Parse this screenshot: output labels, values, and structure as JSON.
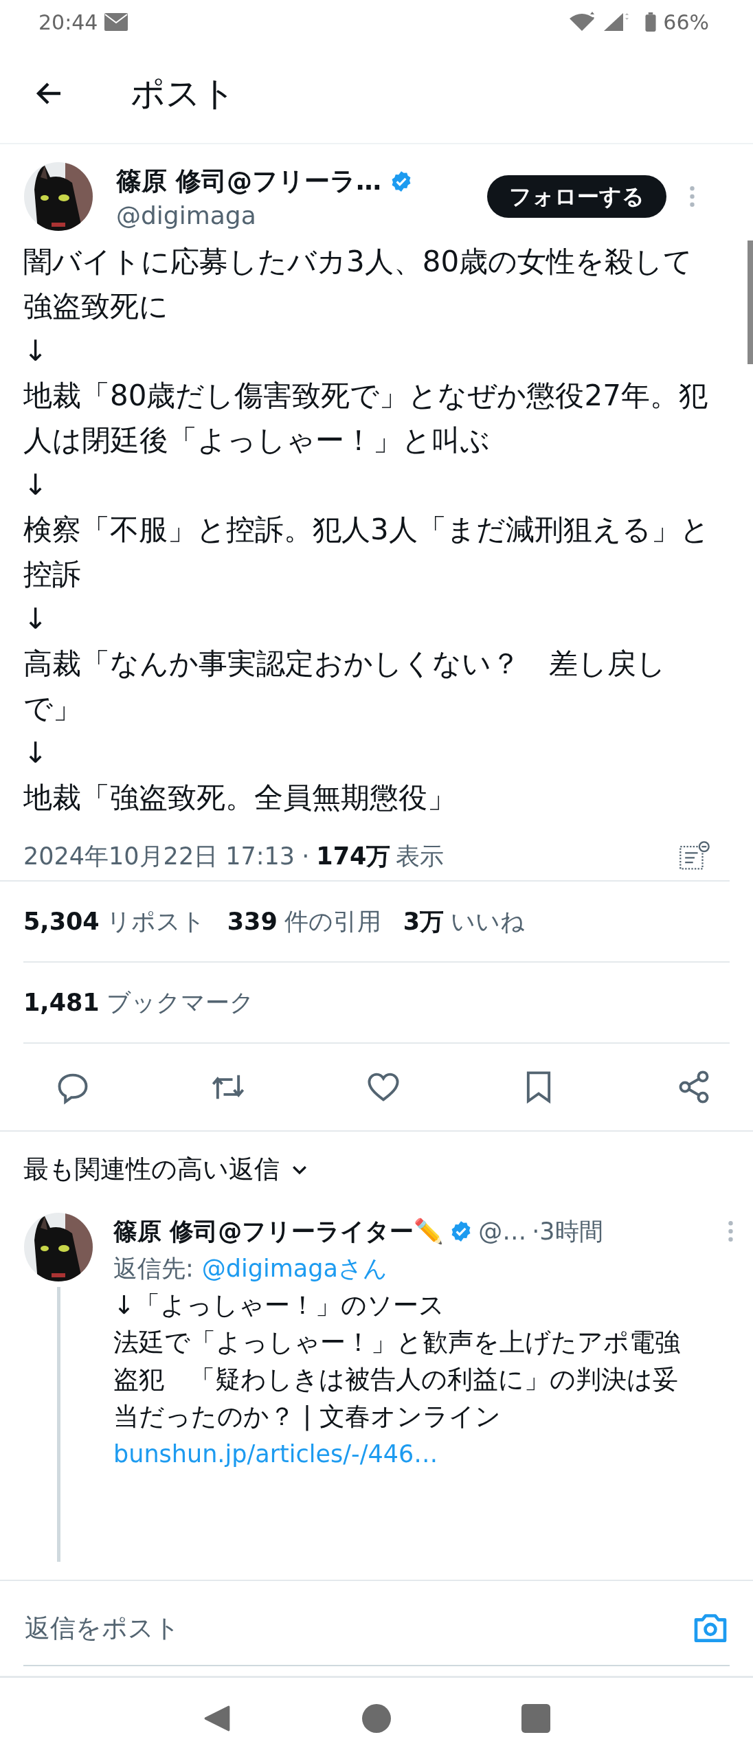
{
  "status_bar": {
    "time": "20:44",
    "battery": "66%"
  },
  "header": {
    "title": "ポスト"
  },
  "post": {
    "author": {
      "name": "篠原 修司@フリーラ…",
      "handle": "@digimaga",
      "verified": true
    },
    "follow_button": "フォローする",
    "lines": [
      "闇バイトに応募したバカ3人、80歳の女性を殺して強盗致死に",
      "↓",
      "地裁「80歳だし傷害致死で」となぜか懲役27年。犯人は閉廷後「よっしゃー！」と叫ぶ",
      "↓",
      "検察「不服」と控訴。犯人3人「まだ減刑狙える」と控訴",
      "↓",
      "高裁「なんか事実認定おかしくない？　差し戻しで」",
      "↓",
      "地裁「強盗致死。全員無期懲役」"
    ],
    "timestamp": "2024年10月22日 17:13",
    "separator": "·",
    "views_count": "174万",
    "views_label": "表示",
    "stats": [
      {
        "count": "5,304",
        "label": "リポスト"
      },
      {
        "count": "339",
        "label": "件の引用"
      },
      {
        "count": "3万",
        "label": "いいね"
      }
    ],
    "bookmarks": {
      "count": "1,481",
      "label": "ブックマーク"
    }
  },
  "replies_sort": {
    "label": "最も関連性の高い返信"
  },
  "replies": [
    {
      "name": "篠原 修司@フリーライター✏️",
      "verified": true,
      "handle": "@…",
      "time": "·3時間",
      "reply_to_label": "返信先:",
      "reply_to": "@digimagaさん",
      "lines": [
        "↓「よっしゃー！」のソース",
        "法廷で「よっしゃー！」と歓声を上げたアポ電強盗犯　「疑わしきは被告人の利益に」の判決は妥当だったのか？ | 文春オンライン"
      ],
      "link": "bunshun.jp/articles/-/446…"
    }
  ],
  "composer": {
    "placeholder": "返信をポスト"
  }
}
